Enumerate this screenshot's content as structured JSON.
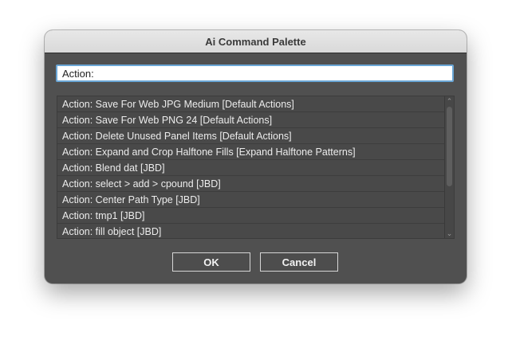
{
  "dialog": {
    "title": "Ai Command Palette",
    "query": {
      "value": "Action:",
      "placeholder": ""
    },
    "results": [
      "Action: Save For Web JPG Medium [Default Actions]",
      "Action: Save For Web PNG 24 [Default Actions]",
      "Action: Delete Unused Panel Items [Default Actions]",
      "Action: Expand and Crop Halftone Fills [Expand Halftone Patterns]",
      "Action: Blend dat [JBD]",
      "Action: select > add > cpound [JBD]",
      "Action: Center Path Type [JBD]",
      "Action: tmp1 [JBD]",
      "Action: fill object [JBD]"
    ],
    "buttons": {
      "ok": "OK",
      "cancel": "Cancel"
    },
    "scroll": {
      "up_icon": "chevron-up",
      "down_icon": "chevron-down"
    }
  },
  "colors": {
    "dialog_bg": "#505050",
    "list_bg": "#494949",
    "focus_ring": "#6aa6d6",
    "text": "#ececec"
  }
}
